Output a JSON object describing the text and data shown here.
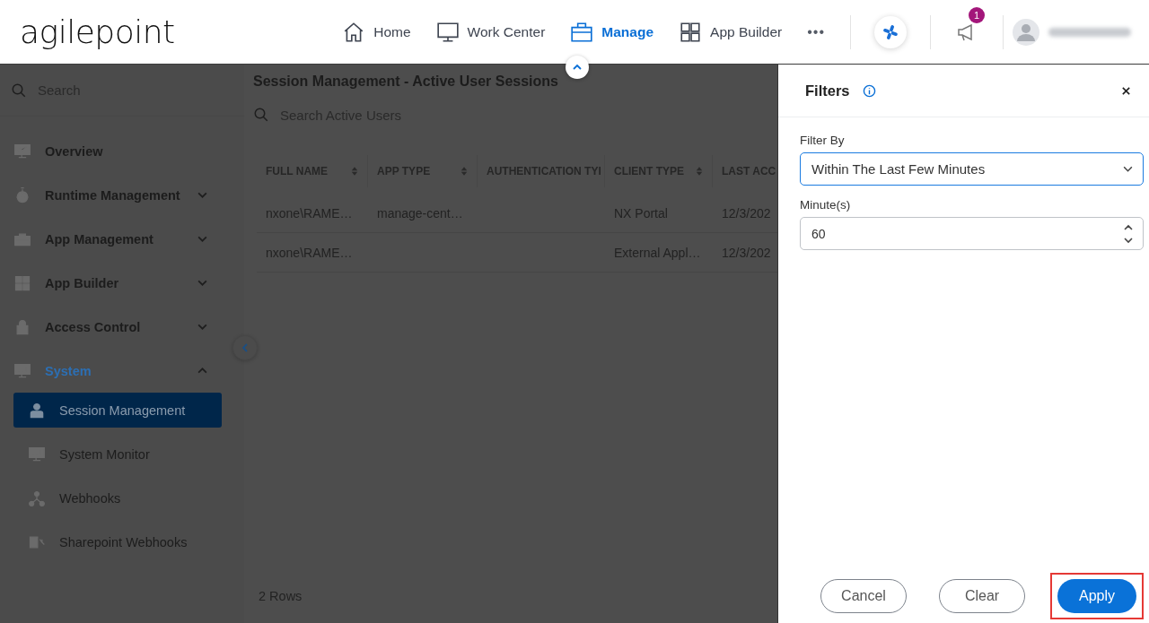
{
  "header": {
    "logo": "agilepoint",
    "nav": [
      {
        "label": "Home",
        "selected": false
      },
      {
        "label": "Work Center",
        "selected": false
      },
      {
        "label": "Manage",
        "selected": true
      },
      {
        "label": "App Builder",
        "selected": false
      }
    ],
    "more": "•••",
    "notifications": "1"
  },
  "sidebar": {
    "search": {
      "placeholder": "Search"
    },
    "items": [
      {
        "label": "Overview"
      },
      {
        "label": "Runtime Management",
        "expanded": false
      },
      {
        "label": "App Management",
        "expanded": false
      },
      {
        "label": "App Builder",
        "expanded": false
      },
      {
        "label": "Access Control",
        "expanded": false
      },
      {
        "label": "System",
        "expanded": true,
        "children": [
          {
            "label": "Session Management",
            "selected": true
          },
          {
            "label": "System Monitor",
            "selected": false
          },
          {
            "label": "Webhooks",
            "selected": false
          },
          {
            "label": "Sharepoint Webhooks",
            "selected": false
          }
        ]
      }
    ]
  },
  "main": {
    "title": "Session Management - Active User Sessions",
    "search": {
      "placeholder": "Search Active Users"
    },
    "columns": [
      {
        "label": "FULL NAME",
        "sortable": true
      },
      {
        "label": "APP TYPE",
        "sortable": true
      },
      {
        "label": "AUTHENTICATION TYI"
      },
      {
        "label": "CLIENT TYPE",
        "sortable": true
      },
      {
        "label": "LAST ACC",
        "sortable": false
      }
    ],
    "rows": [
      {
        "cells": [
          "nxone\\RAME…",
          "manage-cent…",
          null,
          "NX Portal",
          "12/3/202"
        ]
      },
      {
        "cells": [
          "nxone\\RAME…",
          null,
          null,
          "External Appl…",
          "12/3/202"
        ]
      }
    ],
    "footer": "2 Rows"
  },
  "filters": {
    "title": "Filters",
    "fields": [
      {
        "kind": "select",
        "label": "Filter By",
        "value": "Within The Last Few Minutes"
      },
      {
        "kind": "number",
        "label": "Minute(s)",
        "value": "60"
      }
    ],
    "buttons": [
      {
        "label": "Cancel",
        "kind": "secondary",
        "highlighted": false
      },
      {
        "label": "Clear",
        "kind": "secondary",
        "highlighted": false
      },
      {
        "label": "Apply",
        "kind": "primary",
        "highlighted": true
      }
    ]
  }
}
